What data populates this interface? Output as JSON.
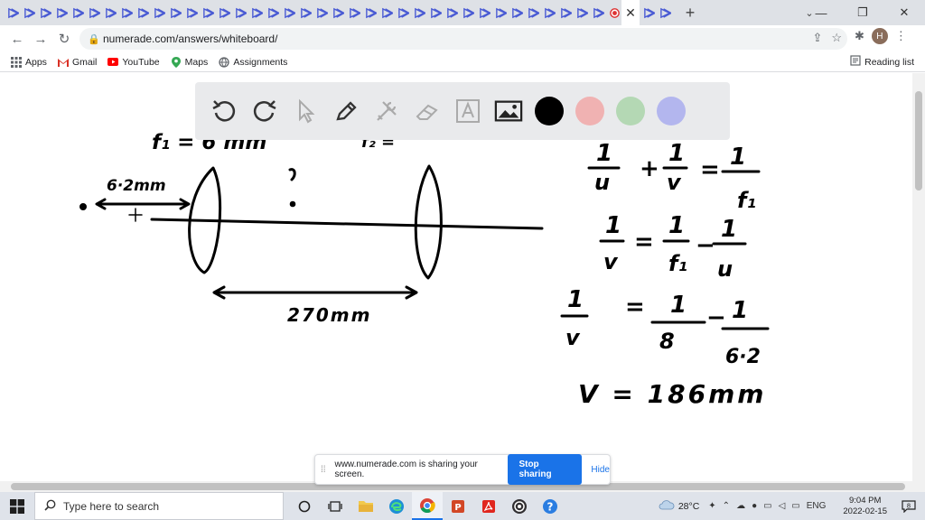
{
  "browser": {
    "active_tab_close": "✕",
    "new_tab": "+",
    "window_controls": [
      "—",
      "❐",
      "✕"
    ],
    "url": "numerade.com/answers/whiteboard/",
    "avatar_letter": "H"
  },
  "bookmarks": {
    "items": [
      "Apps",
      "Gmail",
      "YouTube",
      "Maps",
      "Assignments"
    ],
    "reading_list": "Reading list"
  },
  "whiteboard": {
    "tools": [
      "undo-icon",
      "redo-icon",
      "pointer-icon",
      "pen-icon",
      "tools-icon",
      "eraser-icon",
      "text-icon",
      "image-icon"
    ],
    "colors": [
      "#000000",
      "#f0b2b2",
      "#b4d8b4",
      "#b3b6ee"
    ],
    "left_notes": {
      "f1_label": "f₁ = 6 mm",
      "f2_label": "f₂ =",
      "distance_u": "6·2mm",
      "separation": "270mm"
    },
    "equations": {
      "eq1_lhs": "1/u + 1/v = 1/f₁",
      "eq2": "1/v = 1/f₁ − 1/u",
      "eq3": "1/v = 1/8 − 1/6·2",
      "result": "V = 186mm"
    }
  },
  "share_bar": {
    "message": "www.numerade.com is sharing your screen.",
    "stop_label": "Stop sharing",
    "hide_label": "Hide"
  },
  "taskbar": {
    "search_placeholder": "Type here to search",
    "temperature": "28°C",
    "language": "ENG",
    "time": "9:04 PM",
    "date": "2022-02-15",
    "notification_count": "8"
  }
}
